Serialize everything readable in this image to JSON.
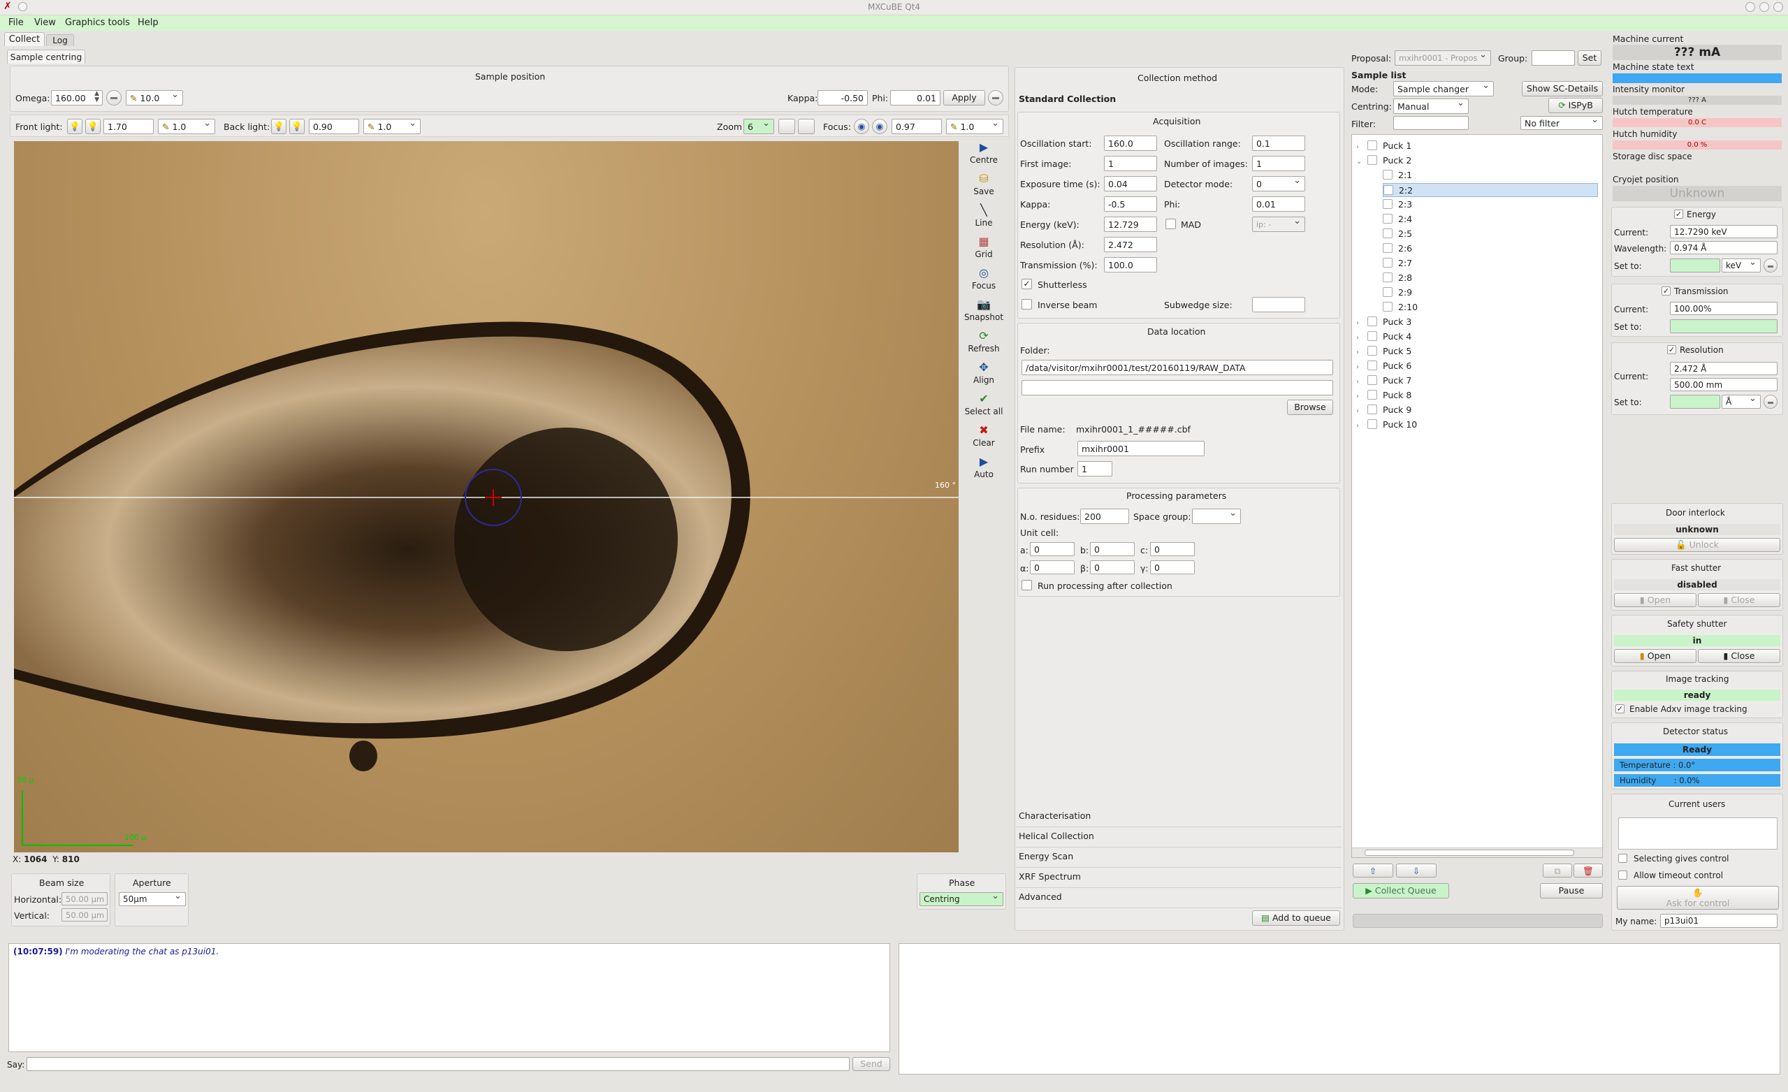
{
  "window": {
    "title": "MXCuBE Qt4"
  },
  "menubar": [
    "File",
    "View",
    "Graphics tools",
    "Help"
  ],
  "main_tabs": [
    "Collect",
    "Log"
  ],
  "sub_tabs": [
    "Sample centring"
  ],
  "sample_position": {
    "title": "Sample position",
    "omega_label": "Omega:",
    "omega_value": "160.00",
    "omega_step": "10.0",
    "kappa_label": "Kappa:",
    "kappa_value": "-0.50",
    "phi_label": "Phi:",
    "phi_value": "0.01",
    "apply_label": "Apply",
    "front_light_label": "Front light:",
    "front_light_value": "1.70",
    "front_light_step": "1.0",
    "back_light_label": "Back light:",
    "back_light_value": "0.90",
    "back_light_step": "1.0",
    "zoom_label": "Zoom",
    "zoom_value": "6",
    "focus_label": "Focus:",
    "focus_value": "0.97",
    "focus_step": "1.0"
  },
  "video": {
    "angle_label": "160 °",
    "scale_y": "50 µ",
    "scale_x": "100 µ",
    "coords_x_label": "X:",
    "coords_x": "1064",
    "coords_y_label": "Y:",
    "coords_y": "810"
  },
  "toolbar": [
    "Centre",
    "Save",
    "Line",
    "Grid",
    "Focus",
    "Snapshot",
    "Refresh",
    "Align",
    "Select all",
    "Clear",
    "Auto"
  ],
  "beam_size": {
    "title": "Beam size",
    "horizontal_label": "Horizontal:",
    "horizontal_value": "50.00 µm",
    "vertical_label": "Vertical:",
    "vertical_value": "50.00 µm"
  },
  "aperture": {
    "title": "Aperture",
    "value": "50µm"
  },
  "phase": {
    "title": "Phase",
    "value": "Centring"
  },
  "collection": {
    "title": "Collection method",
    "subtitle": "Standard Collection",
    "acquisition_title": "Acquisition",
    "osc_start_label": "Oscillation start:",
    "osc_start": "160.0",
    "osc_range_label": "Oscillation range:",
    "osc_range": "0.1",
    "first_image_label": "First image:",
    "first_image": "1",
    "num_images_label": "Number of images:",
    "num_images": "1",
    "exposure_label": "Exposure time (s):",
    "exposure": "0.04",
    "detector_mode_label": "Detector mode:",
    "detector_mode": "0",
    "kappa_label": "Kappa:",
    "kappa": "-0.5",
    "phi_label": "Phi:",
    "phi": "0.01",
    "energy_label": "Energy (keV):",
    "energy": "12.729",
    "mad_label": "MAD",
    "mad_select": "ip: -",
    "resolution_label": "Resolution (Å):",
    "resolution": "2.472",
    "transmission_label": "Transmission (%):",
    "transmission": "100.0",
    "shutterless_label": "Shutterless",
    "inverse_beam_label": "Inverse beam",
    "subwedge_label": "Subwedge size:",
    "data_location_title": "Data location",
    "folder_label": "Folder:",
    "folder": "/data/visitor/mxihr0001/test/20160119/RAW_DATA",
    "browse_label": "Browse",
    "file_name_label": "File name:",
    "file_name": "mxihr0001_1_#####.cbf",
    "prefix_label": "Prefix",
    "prefix": "mxihr0001",
    "run_number_label": "Run number",
    "run_number": "1",
    "processing_title": "Processing parameters",
    "residues_label": "N.o. residues:",
    "residues": "200",
    "space_group_label": "Space group:",
    "unit_cell_label": "Unit cell:",
    "cell_a_label": "a:",
    "cell_a": "0",
    "cell_b_label": "b:",
    "cell_b": "0",
    "cell_c_label": "c:",
    "cell_c": "0",
    "cell_alpha_label": "α:",
    "cell_alpha": "0",
    "cell_beta_label": "β:",
    "cell_beta": "0",
    "cell_gamma_label": "γ:",
    "cell_gamma": "0",
    "run_processing_label": "Run processing after collection",
    "other_methods": [
      "Characterisation",
      "Helical Collection",
      "Energy Scan",
      "XRF Spectrum",
      "Advanced"
    ],
    "add_to_queue_label": "Add to queue"
  },
  "queue": {
    "proposal_label": "Proposal:",
    "proposal_value": "mxihr0001 - Propos",
    "group_label": "Group:",
    "set_label": "Set",
    "sample_list_label": "Sample list",
    "mode_label": "Mode:",
    "mode_value": "Sample changer",
    "show_sc_label": "Show SC-Details",
    "centring_label": "Centring:",
    "centring_value": "Manual",
    "ispyb_label": "ISPyB",
    "filter_label": "Filter:",
    "filter_select": "No filter",
    "tree": [
      {
        "label": "Puck 1",
        "level": 0,
        "arrow": "›"
      },
      {
        "label": "Puck 2",
        "level": 0,
        "arrow": "⌄"
      },
      {
        "label": "2:1",
        "level": 1,
        "arrow": ""
      },
      {
        "label": "2:2",
        "level": 1,
        "arrow": "",
        "selected": true
      },
      {
        "label": "2:3",
        "level": 1,
        "arrow": ""
      },
      {
        "label": "2:4",
        "level": 1,
        "arrow": ""
      },
      {
        "label": "2:5",
        "level": 1,
        "arrow": ""
      },
      {
        "label": "2:6",
        "level": 1,
        "arrow": ""
      },
      {
        "label": "2:7",
        "level": 1,
        "arrow": ""
      },
      {
        "label": "2:8",
        "level": 1,
        "arrow": ""
      },
      {
        "label": "2:9",
        "level": 1,
        "arrow": ""
      },
      {
        "label": "2:10",
        "level": 1,
        "arrow": ""
      },
      {
        "label": "Puck 3",
        "level": 0,
        "arrow": "›"
      },
      {
        "label": "Puck 4",
        "level": 0,
        "arrow": "›"
      },
      {
        "label": "Puck 5",
        "level": 0,
        "arrow": "›"
      },
      {
        "label": "Puck 6",
        "level": 0,
        "arrow": "›"
      },
      {
        "label": "Puck 7",
        "level": 0,
        "arrow": "›"
      },
      {
        "label": "Puck 8",
        "level": 0,
        "arrow": "›"
      },
      {
        "label": "Puck 9",
        "level": 0,
        "arrow": "›"
      },
      {
        "label": "Puck 10",
        "level": 0,
        "arrow": "›"
      }
    ],
    "collect_queue_label": "Collect Queue",
    "pause_label": "Pause"
  },
  "status": {
    "machine_current_label": "Machine current",
    "machine_current": "??? mA",
    "machine_state_label": "Machine state text",
    "intensity_label": "Intensity monitor",
    "intensity": "??? A",
    "hutch_temp_label": "Hutch temperature",
    "hutch_temp": "0.0 C",
    "hutch_hum_label": "Hutch humidity",
    "hutch_hum": "0.0 %",
    "disc_label": "Storage disc space",
    "cryojet_label": "Cryojet position",
    "cryojet": "Unknown",
    "energy_title": "Energy",
    "energy_current_label": "Current:",
    "energy_current": "12.7290 keV",
    "wavelength_label": "Wavelength:",
    "wavelength": "0.974 Å",
    "energy_set_label": "Set to:",
    "energy_unit": "keV",
    "transmission_title": "Transmission",
    "trans_current_label": "Current:",
    "trans_current": "100.00%",
    "trans_set_label": "Set to:",
    "resolution_title": "Resolution",
    "res_current_label": "Current:",
    "res_current": "2.472 Å",
    "res_current2": "500.00 mm",
    "res_set_label": "Set to:",
    "res_unit": "Å",
    "door_title": "Door interlock",
    "door_state": "unknown",
    "unlock_label": "Unlock",
    "fast_shutter_title": "Fast shutter",
    "fast_shutter_state": "disabled",
    "open_label": "Open",
    "close_label": "Close",
    "safety_shutter_title": "Safety shutter",
    "safety_shutter_state": "in",
    "image_tracking_title": "Image tracking",
    "image_tracking_state": "ready",
    "adxv_label": "Enable Adxv image tracking",
    "detector_title": "Detector status",
    "detector_state": "Ready",
    "det_temp": "Temperature : 0.0°",
    "det_hum": "Humidity       : 0.0%",
    "users_title": "Current users",
    "selecting_label": "Selecting gives control",
    "timeout_label": "Allow timeout control",
    "ask_control_label": "Ask for control",
    "my_name_label": "My name:",
    "my_name": "p13ui01"
  },
  "chat": {
    "time": "(10:07:59)",
    "message": "I'm moderating the chat as p13ui01.",
    "say_label": "Say:",
    "send_label": "Send"
  },
  "colors": {
    "accent_green": "#d5f5cf",
    "blue_status": "#3ea8f0",
    "pink_status": "#f6c6c6",
    "ready_green": "#c9f3c9"
  }
}
